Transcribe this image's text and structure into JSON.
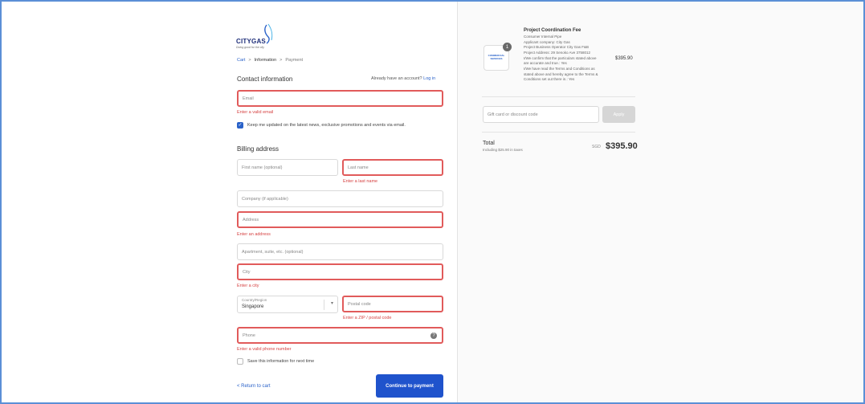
{
  "brand": {
    "name_city": "CITY",
    "name_gas": "GAS",
    "tagline": "Doing good for the city"
  },
  "breadcrumb": {
    "cart": "Cart",
    "information": "Information",
    "payment": "Payment",
    "separator": ">"
  },
  "contact": {
    "title": "Contact information",
    "account_prompt": "Already have an account?",
    "login_link": "Log in",
    "email_placeholder": "Email",
    "email_error": "Enter a valid email",
    "marketing_opt_in": "Keep me updated on the latest news, exclusive promotions and events via email.",
    "marketing_checked": true
  },
  "billing": {
    "title": "Billing address",
    "first_name_placeholder": "First name (optional)",
    "last_name_placeholder": "Last name",
    "last_name_error": "Enter a last name",
    "company_placeholder": "Company (if applicable)",
    "address_placeholder": "Address",
    "address_error": "Enter an address",
    "apartment_placeholder": "Apartment, suite, etc. (optional)",
    "city_placeholder": "City",
    "city_error": "Enter a city",
    "country_label": "Country/Region",
    "country_value": "Singapore",
    "postal_placeholder": "Postal code",
    "postal_error": "Enter a ZIP / postal code",
    "phone_placeholder": "Phone",
    "phone_error": "Enter a valid phone number",
    "save_info": "Save this information for next time",
    "save_info_checked": false
  },
  "actions": {
    "return_link": "< Return to cart",
    "continue_button": "Continue to payment"
  },
  "summary": {
    "thumb_text": "COMMERCIAL SERVICES",
    "quantity": "1",
    "product_title": "Project Coordination Fee",
    "details": [
      "Consumer Internal Pipe",
      "Applicant company: City Gas",
      "Project Business Operator City Gas F&B",
      "Project Address: 29 Senoko Ave 3758012",
      "I/We confirm that the particulars stated above",
      "are accurate and true.: Yes",
      "I/We have read the Terms and Conditions as",
      "stated above and hereby agree to the Terms &",
      "Conditions set out there in.: Yes"
    ],
    "price": "$395.90",
    "discount_placeholder": "Gift card or discount code",
    "apply_button": "Apply",
    "total_label": "Total",
    "tax_note": "Including $25.90 in taxes",
    "currency": "SGD",
    "total_amount": "$395.90"
  },
  "colors": {
    "accent": "#1f53cc",
    "link": "#2a62c9",
    "error": "#e15b5b",
    "frame": "#5b8fd6"
  }
}
